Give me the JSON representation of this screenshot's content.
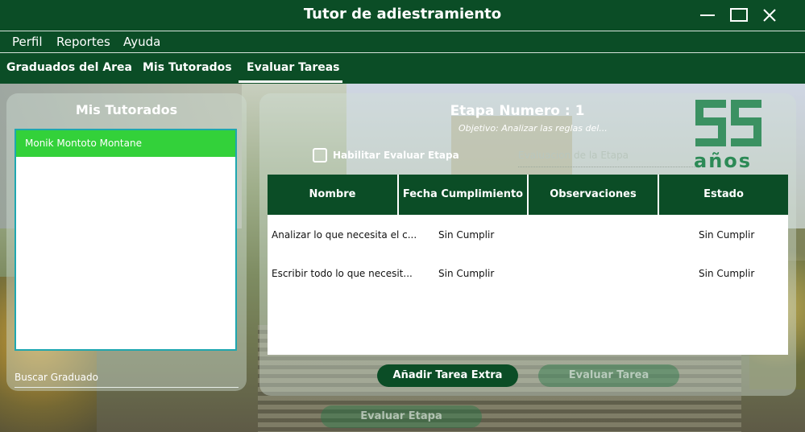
{
  "window": {
    "title": "Tutor de adiestramiento"
  },
  "menu": {
    "items": [
      "Perfil",
      "Reportes",
      "Ayuda"
    ]
  },
  "tabs": {
    "items": [
      "Graduados del Area",
      "Mis Tutorados",
      "Evaluar Tareas"
    ],
    "active": "Evaluar Tareas"
  },
  "left_panel": {
    "title": "Mis Tutorados",
    "selected_item": "Monik Montoto Montane",
    "search_label": "Buscar Graduado"
  },
  "right_panel": {
    "stage_title": "Etapa Numero : 1",
    "objective": "Objetivo: Analizar las reglas del...",
    "checkbox_label": "Habilitar Evaluar Etapa",
    "eval_field_label": "Evaluacion de la Etapa",
    "logo_text": "años",
    "table": {
      "headers": [
        "Nombre",
        "Fecha Cumplimiento",
        "Observaciones",
        "Estado"
      ],
      "rows": [
        {
          "nombre": "Analizar lo que necesita el c...",
          "fecha": "Sin Cumplir",
          "observaciones": "",
          "estado": "Sin Cumplir"
        },
        {
          "nombre": "Escribir todo lo que necesit...",
          "fecha": "Sin Cumplir",
          "observaciones": "",
          "estado": "Sin Cumplir"
        }
      ]
    },
    "buttons": {
      "add_task": "Añadir Tarea Extra",
      "evaluate_task": "Evaluar Tarea"
    }
  },
  "bottom": {
    "evaluate_stage": "Evaluar Etapa"
  },
  "colors": {
    "primary": "#0b4d26",
    "selected": "#33d13a",
    "accent_border": "#1fa7b0"
  }
}
